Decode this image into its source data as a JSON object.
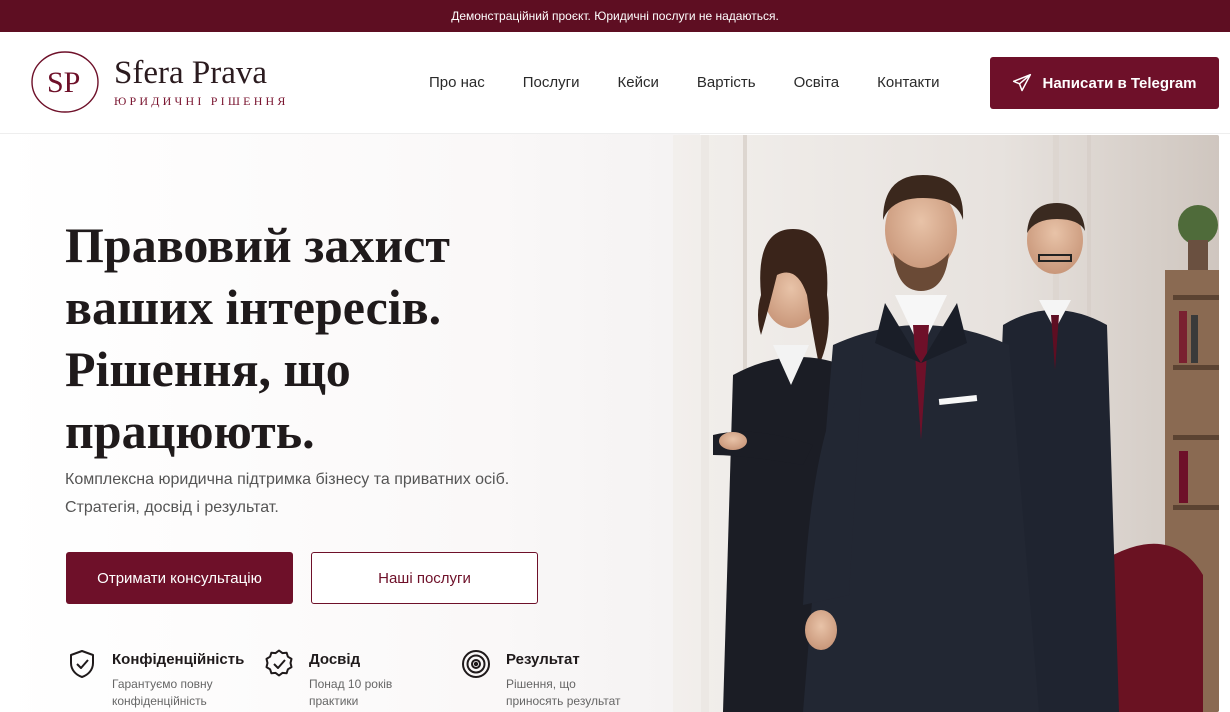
{
  "topbar": {
    "notice": "Демонстраційний проєкт. Юридичні послуги не надаються."
  },
  "brand": {
    "monogram": "SP",
    "name": "Sfera Prava",
    "tagline": "ЮРИДИЧНІ РІШЕННЯ",
    "color": "#6e1029"
  },
  "nav": {
    "items": [
      "Про нас",
      "Послуги",
      "Кейси",
      "Вартість",
      "Освіта",
      "Контакти"
    ]
  },
  "cta": {
    "telegram_label": "Написати в Telegram",
    "telegram_icon": "paper-plane-icon"
  },
  "hero": {
    "title_lines": [
      "Правовий захист",
      "ваших інтересів.",
      "Рішення, що",
      "працюють."
    ],
    "subtitle_lines": [
      "Комплексна юридична підтримка бізнесу та приватних осіб.",
      "Стратегія, досвід і результат."
    ],
    "primary_button": "Отримати консультацію",
    "secondary_button": "Наші послуги"
  },
  "features": [
    {
      "icon": "shield-check-icon",
      "title": "Конфіденційність",
      "text_lines": [
        "Гарантуємо повну",
        "конфіденційність"
      ]
    },
    {
      "icon": "badge-check-icon",
      "title": "Досвід",
      "text_lines": [
        "Понад 10 років",
        "практики"
      ]
    },
    {
      "icon": "target-icon",
      "title": "Результат",
      "text_lines": [
        "Рішення, що",
        "приносять результат"
      ]
    }
  ],
  "photo": {
    "icon": "team-photo"
  }
}
